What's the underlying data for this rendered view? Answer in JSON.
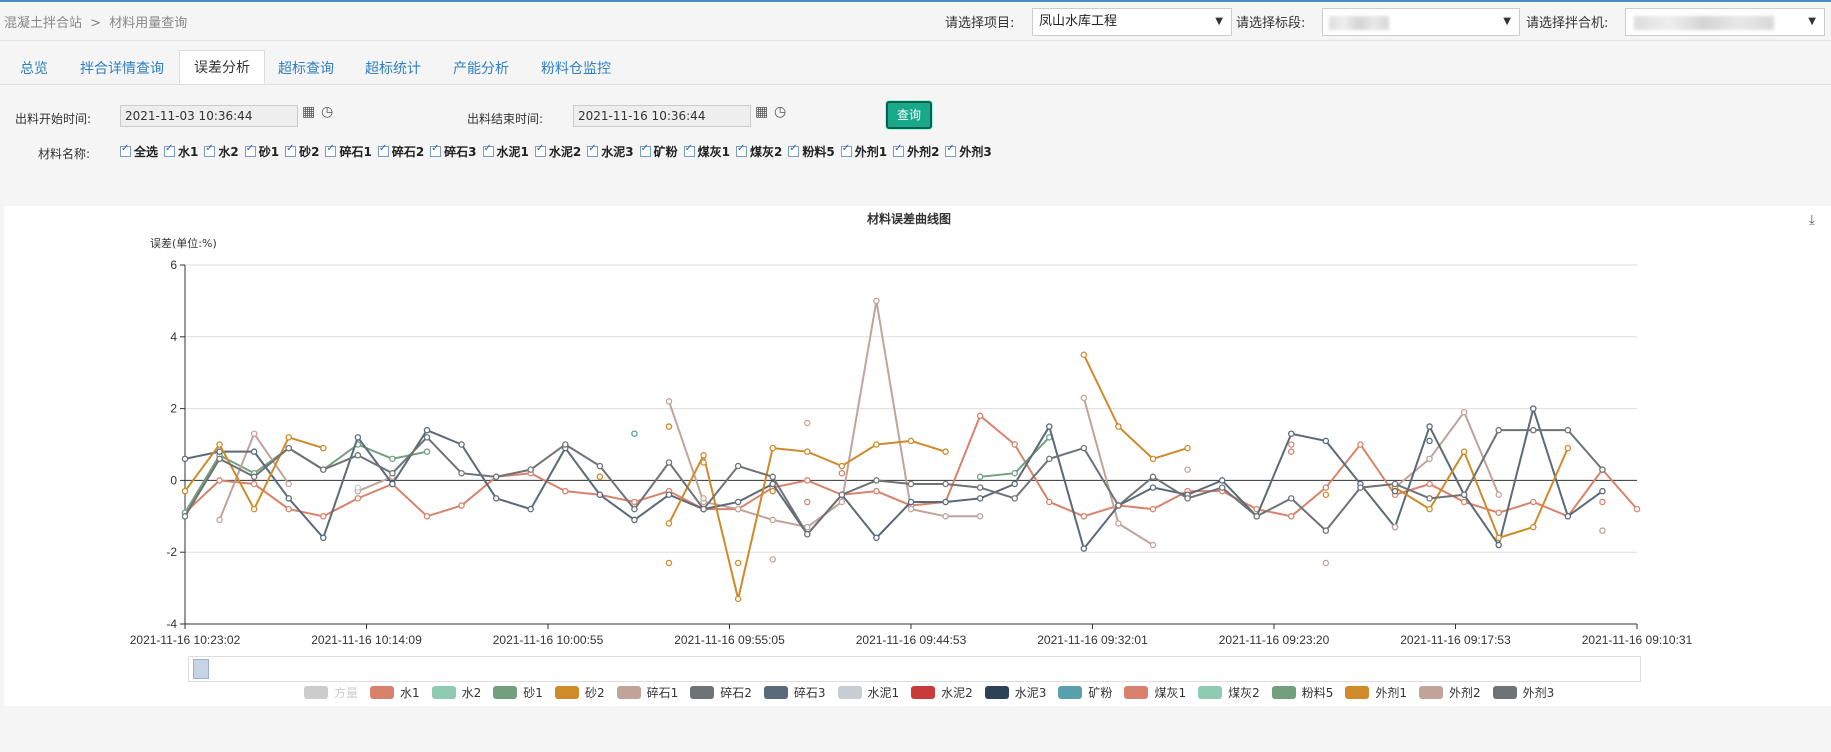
{
  "breadcrumb": [
    "混凝土拌合站",
    ">",
    "材料用量查询"
  ],
  "selectors": {
    "project_label": "请选择项目:",
    "project_value": "凤山水库工程",
    "section_label": "请选择标段:",
    "mixer_label": "请选择拌合机:"
  },
  "tabs": [
    "总览",
    "拌合详情查询",
    "误差分析",
    "超标查询",
    "超标统计",
    "产能分析",
    "粉料仓监控"
  ],
  "active_tab": "误差分析",
  "filters": {
    "start_label": "出料开始时间:",
    "start_value": "2021-11-03 10:36:44",
    "end_label": "出料结束时间:",
    "end_value": "2021-11-16 10:36:44",
    "query_button": "查询",
    "material_label": "材料名称:",
    "materials": [
      "全选",
      "水1",
      "水2",
      "砂1",
      "砂2",
      "碎石1",
      "碎石2",
      "碎石3",
      "水泥1",
      "水泥2",
      "水泥3",
      "矿粉",
      "煤灰1",
      "煤灰2",
      "粉料5",
      "外剂1",
      "外剂2",
      "外剂3"
    ]
  },
  "icons": {
    "calendar": "calendar-icon",
    "clock": "clock-icon",
    "download": "download-icon",
    "caret": "caret-down-icon"
  },
  "chart_data": {
    "type": "line",
    "title": "材料误差曲线图",
    "ylabel": "误差(单位:%)",
    "ylim": [
      -4,
      6
    ],
    "yticks": [
      -4,
      -2,
      0,
      2,
      4,
      6
    ],
    "grid": true,
    "legend_position": "bottom",
    "xtick_labels": [
      "2021-11-16 10:23:02",
      "2021-11-16 10:14:09",
      "2021-11-16 10:00:55",
      "2021-11-16 09:55:05",
      "2021-11-16 09:44:53",
      "2021-11-16 09:32:01",
      "2021-11-16 09:23:20",
      "2021-11-16 09:17:53",
      "2021-11-16 09:10:31"
    ],
    "legend": [
      {
        "name": "方量",
        "color": "#cccccc",
        "off": true
      },
      {
        "name": "水1",
        "color": "#d9826b"
      },
      {
        "name": "水2",
        "color": "#8fcbb0"
      },
      {
        "name": "砂1",
        "color": "#72a07f"
      },
      {
        "name": "砂2",
        "color": "#cf8a2a"
      },
      {
        "name": "碎石1",
        "color": "#c0a49a"
      },
      {
        "name": "碎石2",
        "color": "#6f7376"
      },
      {
        "name": "碎石3",
        "color": "#5b6a78"
      },
      {
        "name": "水泥1",
        "color": "#c7cdd3"
      },
      {
        "name": "水泥2",
        "color": "#c93a3a"
      },
      {
        "name": "水泥3",
        "color": "#2e4157"
      },
      {
        "name": "矿粉",
        "color": "#5aa0ad"
      },
      {
        "name": "煤灰1",
        "color": "#d9826b"
      },
      {
        "name": "煤灰2",
        "color": "#8fcbb0"
      },
      {
        "name": "粉料5",
        "color": "#72a07f"
      },
      {
        "name": "外剂1",
        "color": "#cf8a2a"
      },
      {
        "name": "外剂2",
        "color": "#c0a49a"
      },
      {
        "name": "外剂3",
        "color": "#6f7376"
      }
    ],
    "series": [
      {
        "name": "水1",
        "color": "#d9826b",
        "values": [
          -0.9,
          0,
          -0.1,
          -0.8,
          -1.0,
          -0.5,
          -0.1,
          -1.0,
          -0.7,
          0.1,
          0.2,
          -0.3,
          -0.4,
          -0.6,
          -0.3,
          -0.8,
          -0.8,
          -0.2,
          0,
          -0.4,
          -0.3,
          -0.7,
          -0.6,
          1.8,
          1.0,
          -0.6,
          -1.0,
          -0.7,
          -0.8,
          -0.3,
          -0.3,
          -0.8,
          -1.0,
          -0.2,
          1.0,
          -0.4,
          -0.1,
          -0.6,
          -0.9,
          -0.6,
          -1.0,
          0.3,
          -0.8
        ]
      },
      {
        "name": "砂1",
        "color": "#72a07f",
        "values": [
          -0.9,
          0.7,
          0.2,
          0.9,
          0.3,
          1.0,
          0.6,
          0.8,
          null,
          null,
          null,
          null,
          null,
          null,
          null,
          null,
          null,
          null,
          null,
          null,
          null,
          null,
          null,
          0.1,
          0.2,
          1.2,
          null,
          null,
          null,
          null,
          null,
          null,
          null,
          null,
          null,
          null,
          null,
          null,
          null,
          null,
          null,
          null,
          null
        ]
      },
      {
        "name": "碎石1",
        "color": "#c0a49a",
        "values": [
          null,
          -1.1,
          1.3,
          -0.1,
          null,
          -0.3,
          0.1,
          null,
          null,
          null,
          null,
          null,
          null,
          null,
          2.2,
          -0.6,
          -0.8,
          -1.1,
          -1.3,
          -0.6,
          5.0,
          -0.8,
          -1.0,
          -1.0,
          null,
          null,
          2.3,
          -1.2,
          -1.8,
          null,
          null,
          null,
          null,
          -2.3,
          null,
          -0.2,
          0.6,
          1.9,
          -0.4,
          null,
          null,
          null,
          null
        ]
      },
      {
        "name": "碎石3",
        "color": "#5b6a78",
        "values": [
          0.6,
          0.8,
          0.8,
          -0.5,
          -1.6,
          1.2,
          -0.1,
          1.4,
          1.0,
          -0.5,
          -0.8,
          0.9,
          -0.4,
          -1.1,
          -0.4,
          -0.8,
          -0.6,
          -0.1,
          -1.5,
          -0.4,
          -1.6,
          -0.6,
          -0.6,
          -0.5,
          -0.1,
          1.5,
          -1.9,
          -0.7,
          -0.2,
          -0.4,
          0,
          -1.0,
          1.3,
          1.1,
          -0.1,
          -1.3,
          1.5,
          -0.4,
          -1.8,
          2.0,
          -1.0,
          -0.3,
          null
        ]
      },
      {
        "name": "外剂1",
        "color": "#cf8a2a",
        "values": [
          -0.3,
          1.0,
          -0.8,
          1.2,
          0.9,
          null,
          null,
          null,
          null,
          null,
          null,
          null,
          null,
          null,
          -1.2,
          0.7,
          -3.3,
          0.9,
          0.8,
          0.4,
          1.0,
          1.1,
          0.8,
          null,
          null,
          null,
          3.5,
          1.5,
          0.6,
          0.9,
          null,
          null,
          null,
          null,
          null,
          -0.2,
          -0.8,
          0.8,
          -1.6,
          -1.3,
          0.9,
          null,
          null
        ]
      },
      {
        "name": "外剂3",
        "color": "#6f7376",
        "values": [
          -1.0,
          0.6,
          0.1,
          0.9,
          0.3,
          0.7,
          0.2,
          1.2,
          0.2,
          0.1,
          0.3,
          1.0,
          0.4,
          -0.8,
          0.5,
          -0.8,
          0.4,
          0.1,
          -1.5,
          -0.4,
          0,
          -0.1,
          -0.1,
          -0.2,
          -0.5,
          0.6,
          0.9,
          -0.7,
          0.1,
          -0.5,
          -0.2,
          -1.0,
          -0.5,
          -1.4,
          -0.2,
          -0.1,
          -0.5,
          -0.4,
          1.4,
          1.4,
          1.4,
          0.3,
          null
        ]
      },
      {
        "name": "水泥1",
        "color": "#c7cdd3",
        "values": [
          null,
          null,
          null,
          null,
          null,
          -0.2,
          null,
          null,
          null,
          null,
          null,
          null,
          null,
          null,
          null,
          null,
          null,
          null,
          null,
          null,
          null,
          null,
          null,
          null,
          null,
          null,
          null,
          null,
          null,
          null,
          null,
          null,
          null,
          null,
          null,
          null,
          null,
          null,
          null,
          null,
          null,
          null,
          null
        ]
      },
      {
        "name": "矿粉",
        "color": "#5aa0ad",
        "values": [
          null,
          null,
          null,
          null,
          null,
          null,
          null,
          null,
          null,
          null,
          null,
          null,
          null,
          1.3,
          null,
          null,
          null,
          null,
          null,
          null,
          null,
          null,
          null,
          null,
          null,
          null,
          null,
          null,
          null,
          null,
          null,
          null,
          null,
          null,
          null,
          null,
          null,
          null,
          null,
          null,
          null,
          null,
          null
        ]
      }
    ],
    "scatter_extra": [
      {
        "color": "#cf8a2a",
        "points": [
          [
            14,
            1.5
          ],
          [
            14,
            -2.3
          ],
          [
            15,
            0.5
          ],
          [
            16,
            -2.3
          ],
          [
            17,
            -0.3
          ],
          [
            12,
            0.1
          ],
          [
            33,
            -0.4
          ]
        ]
      },
      {
        "color": "#c0a49a",
        "points": [
          [
            17,
            -2.2
          ],
          [
            18,
            1.6
          ],
          [
            15,
            -0.5
          ],
          [
            35,
            -1.3
          ],
          [
            41,
            -1.4
          ],
          [
            29,
            0.3
          ]
        ]
      },
      {
        "color": "#d9826b",
        "points": [
          [
            18,
            -0.6
          ],
          [
            19,
            0.2
          ],
          [
            32,
            1.0
          ],
          [
            32,
            0.8
          ],
          [
            41,
            -0.6
          ]
        ]
      },
      {
        "color": "#5b6a78",
        "points": [
          [
            36,
            1.1
          ],
          [
            35,
            -0.3
          ]
        ]
      }
    ]
  }
}
